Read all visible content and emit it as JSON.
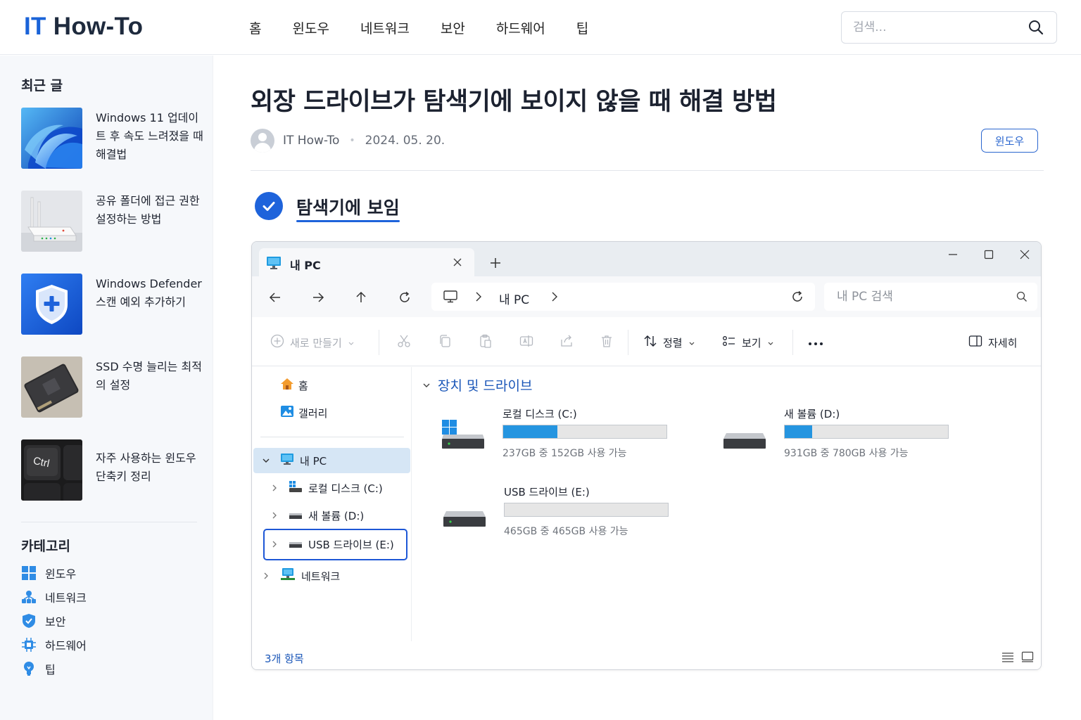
{
  "header": {
    "logo_prefix": "IT",
    "logo_suffix": "How-To",
    "nav": [
      "홈",
      "윈도우",
      "네트워크",
      "보안",
      "하드웨어",
      "팁"
    ],
    "search_placeholder": "검색..."
  },
  "sidebar": {
    "recent_heading": "최근 글",
    "recent_posts": [
      {
        "title": "Windows 11 업데이트 후 속도 느려졌을 때 해결법",
        "thumb": "windows-bloom"
      },
      {
        "title": "공유 폴더에 접근 권한 설정하는 방법",
        "thumb": "router"
      },
      {
        "title": "Windows Defender 스캔 예외 추가하기",
        "thumb": "shield"
      },
      {
        "title": "SSD 수명 늘리는 최적의 설정",
        "thumb": "ssd"
      },
      {
        "title": "자주 사용하는 윈도우 단축키 정리",
        "thumb": "ctrl-key",
        "key_text": "Ctrl"
      }
    ],
    "category_heading": "카테고리",
    "categories": [
      {
        "label": "윈도우",
        "icon": "windows-icon"
      },
      {
        "label": "네트워크",
        "icon": "network-icon"
      },
      {
        "label": "보안",
        "icon": "shield-icon"
      },
      {
        "label": "하드웨어",
        "icon": "chip-icon"
      },
      {
        "label": "팁",
        "icon": "lightbulb-icon"
      }
    ]
  },
  "article": {
    "title": "외장 드라이브가 탐색기에 보이지 않을 때 해결 방법",
    "author": "IT How-To",
    "date": "2024. 05. 20.",
    "category": "윈도우",
    "status_text": "탐색기에 보임"
  },
  "explorer": {
    "tab_title": "내 PC",
    "address_label": "내 PC",
    "search_placeholder": "내 PC 검색",
    "toolbar": {
      "new_label": "새로 만들기",
      "sort_label": "정렬",
      "view_label": "보기",
      "details_label": "자세히"
    },
    "nav_pane": {
      "home": "홈",
      "gallery": "갤러리",
      "this_pc": "내 PC",
      "drive_c": "로컬 디스크 (C:)",
      "drive_d": "새 볼륨 (D:)",
      "drive_e": "USB 드라이브 (E:)",
      "network": "네트워크"
    },
    "group_header": "장치 및 드라이브",
    "drives": [
      {
        "name": "로컬 디스크 (C:)",
        "size_text": "237GB 중 152GB 사용 가능",
        "used_fraction": 0.33,
        "icon": "windows-drive-icon"
      },
      {
        "name": "새 볼륨 (D:)",
        "size_text": "931GB 중 780GB 사용 가능",
        "used_fraction": 0.17,
        "icon": "hdd-icon"
      },
      {
        "name": "USB 드라이브 (E:)",
        "size_text": "465GB 중 465GB 사용 가능",
        "used_fraction": 0.0,
        "icon": "usb-drive-icon"
      }
    ],
    "item_count": "3개 항목"
  },
  "colors": {
    "accent": "#1e63db",
    "drive_bar": "#2595e0",
    "selection": "#d6e6f5"
  }
}
